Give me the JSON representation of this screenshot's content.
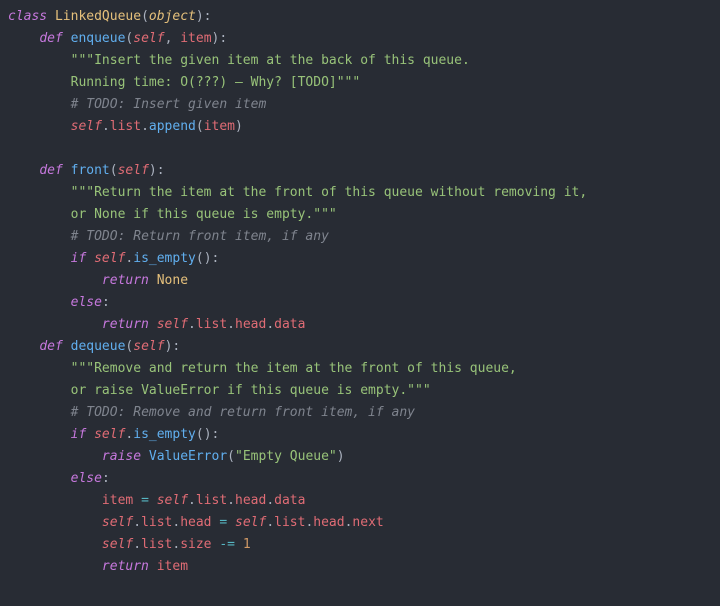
{
  "code": {
    "l01_kw_class": "class",
    "l01_cls": "LinkedQueue",
    "l01_obj": "object",
    "l02_kw_def": "def",
    "l02_fn": "enqueue",
    "l02_self": "self",
    "l02_p1": "item",
    "l03_doc": "\"\"\"Insert the given item at the back of this queue.",
    "l04_doc": "Running time: O(???) – Why? [TODO]\"\"\"",
    "l05_cmt": "# TODO: Insert given item",
    "l06_self": "self",
    "l06_a1": "list",
    "l06_call": "append",
    "l06_arg": "item",
    "l08_kw_def": "def",
    "l08_fn": "front",
    "l08_self": "self",
    "l09_doc": "\"\"\"Return the item at the front of this queue without removing it,",
    "l10_doc": "or None if this queue is empty.\"\"\"",
    "l11_cmt": "# TODO: Return front item, if any",
    "l12_kw_if": "if",
    "l12_self": "self",
    "l12_call": "is_empty",
    "l13_kw_ret": "return",
    "l13_none": "None",
    "l14_kw_else": "else",
    "l15_kw_ret": "return",
    "l15_self": "self",
    "l15_a1": "list",
    "l15_a2": "head",
    "l15_a3": "data",
    "l16_kw_def": "def",
    "l16_fn": "dequeue",
    "l16_self": "self",
    "l17_doc": "\"\"\"Remove and return the item at the front of this queue,",
    "l18_doc": "or raise ValueError if this queue is empty.\"\"\"",
    "l19_cmt": "# TODO: Remove and return front item, if any",
    "l20_kw_if": "if",
    "l20_self": "self",
    "l20_call": "is_empty",
    "l21_kw_raise": "raise",
    "l21_err": "ValueError",
    "l21_msg": "\"Empty Queue\"",
    "l22_kw_else": "else",
    "l23_var": "item",
    "l23_self": "self",
    "l23_a1": "list",
    "l23_a2": "head",
    "l23_a3": "data",
    "l24_self1": "self",
    "l24_a1": "list",
    "l24_a2": "head",
    "l24_self2": "self",
    "l24_b1": "list",
    "l24_b2": "head",
    "l24_b3": "next",
    "l25_self": "self",
    "l25_a1": "list",
    "l25_a2": "size",
    "l25_op": "-=",
    "l25_num": "1",
    "l26_kw_ret": "return",
    "l26_var": "item"
  }
}
